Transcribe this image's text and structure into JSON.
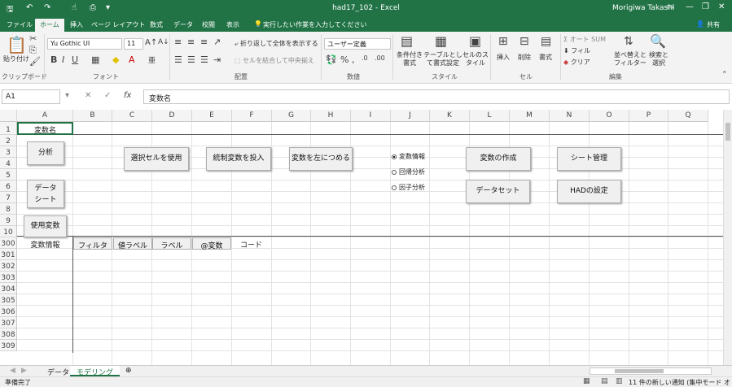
{
  "window": {
    "title": "had17_102 - Excel",
    "user": "Morigiwa Takashi",
    "share": "共有"
  },
  "ribbon_tabs": [
    "ファイル",
    "ホーム",
    "挿入",
    "ページ レイアウト",
    "数式",
    "データ",
    "校閲",
    "表示"
  ],
  "tell_me": "実行したい作業を入力してください",
  "ribbon": {
    "paste": "貼り付け",
    "clipboard": "クリップボード",
    "font_name": "Yu Gothic UI",
    "font_size": "11",
    "font_group": "フォント",
    "wrap_text": "折り返して全体を表示する",
    "merge_center": "セルを結合して中央揃え",
    "alignment_group": "配置",
    "number_format": "ユーザー定義",
    "number_group": "数値",
    "conditional": "条件付き書式",
    "table_format": "テーブルとして書式設定",
    "cell_styles": "セルのスタイル",
    "styles_group": "スタイル",
    "insert": "挿入",
    "delete": "削除",
    "format": "書式",
    "cells_group": "セル",
    "autosum": "オート SUM",
    "fill": "フィル",
    "clear": "クリア",
    "sort_filter": "並べ替えとフィルター",
    "find_select": "検索と選択",
    "editing_group": "編集"
  },
  "formula_bar": {
    "name_box": "A1",
    "fx": "fx",
    "value": "変数名"
  },
  "columns": [
    "A",
    "B",
    "C",
    "D",
    "E",
    "F",
    "G",
    "H",
    "I",
    "J",
    "K",
    "L",
    "M",
    "N",
    "O",
    "P",
    "Q"
  ],
  "rows": [
    "1",
    "2",
    "3",
    "4",
    "5",
    "6",
    "7",
    "8",
    "9",
    "10",
    "300",
    "301",
    "302",
    "303",
    "304",
    "305",
    "306",
    "307",
    "308",
    "309"
  ],
  "cells": {
    "a1": "変数名",
    "a300": "変数情報",
    "b300": "フィルタ",
    "c300": "値ラベル",
    "d300": "ラベル",
    "e300": "@変数",
    "f300": "コード"
  },
  "buttons": {
    "analysis": "分析",
    "data_sheet_1": "データ",
    "data_sheet_2": "シート",
    "used_vars": "使用変数",
    "use_selected": "選択セルを使用",
    "insert_control": "統制変数を投入",
    "shift_left": "変数を左につめる",
    "create_var": "変数の作成",
    "sheet_mgmt": "シート管理",
    "dataset": "データセット",
    "had_settings": "HADの設定"
  },
  "radios": [
    "変数情報",
    "回帰分析",
    "因子分析"
  ],
  "sheets": [
    "データ",
    "モデリング"
  ],
  "status": {
    "ready": "準備完了",
    "notice": "11 件の新しい通知 (集中モード オン)"
  }
}
